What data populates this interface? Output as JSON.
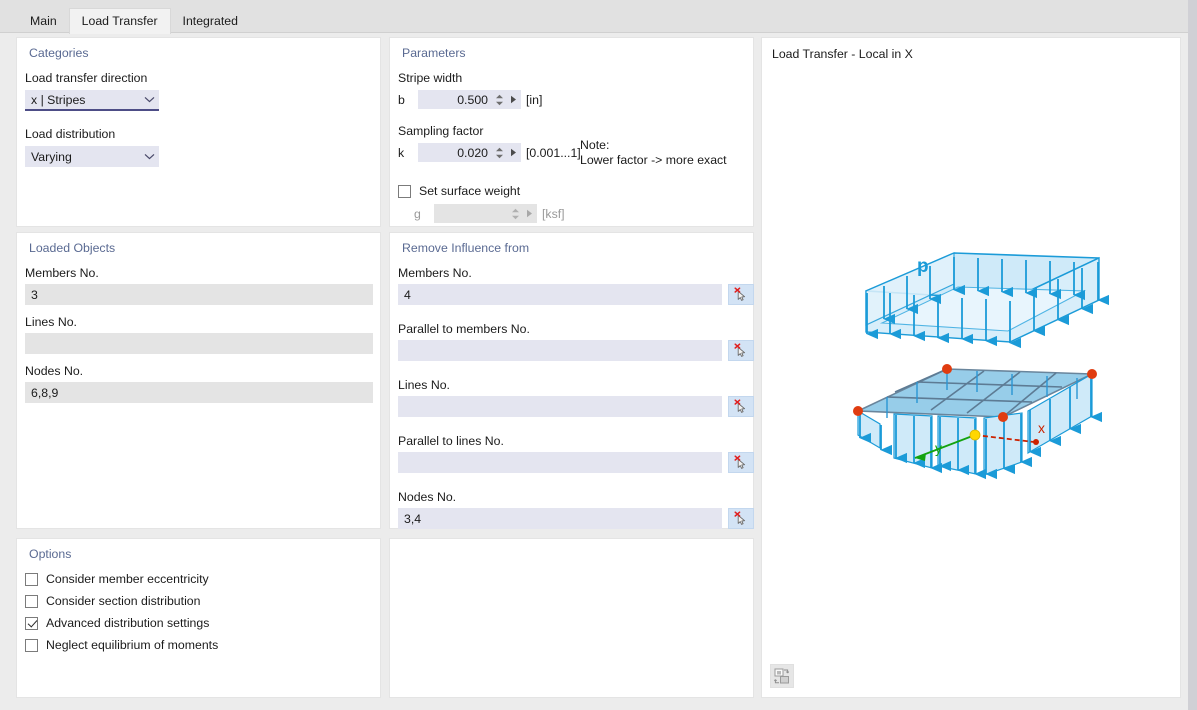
{
  "tabs": [
    {
      "label": "Main",
      "active": false
    },
    {
      "label": "Load Transfer",
      "active": true
    },
    {
      "label": "Integrated",
      "active": false
    }
  ],
  "categories": {
    "title": "Categories",
    "direction_label": "Load transfer direction",
    "direction_value": "x | Stripes",
    "distribution_label": "Load distribution",
    "distribution_value": "Varying"
  },
  "parameters": {
    "title": "Parameters",
    "stripe_width_label": "Stripe width",
    "stripe_width_symbol": "b",
    "stripe_width_value": "0.500",
    "stripe_width_unit": "[in]",
    "sampling_factor_label": "Sampling factor",
    "sampling_factor_symbol": "k",
    "sampling_factor_value": "0.020",
    "sampling_factor_range": "[0.001...1]",
    "note": "Note:\nLower factor -> more exact",
    "set_surface_weight_label": "Set surface weight",
    "set_surface_weight_checked": false,
    "surface_weight_symbol": "g",
    "surface_weight_value": "",
    "surface_weight_unit": "[ksf]"
  },
  "loaded_objects": {
    "title": "Loaded Objects",
    "fields": [
      {
        "label": "Members No.",
        "value": "3"
      },
      {
        "label": "Lines No.",
        "value": ""
      },
      {
        "label": "Nodes No.",
        "value": "6,8,9"
      }
    ]
  },
  "remove_influence": {
    "title": "Remove Influence from",
    "fields": [
      {
        "label": "Members No.",
        "value": "4"
      },
      {
        "label": "Parallel to members No.",
        "value": ""
      },
      {
        "label": "Lines No.",
        "value": ""
      },
      {
        "label": "Parallel to lines No.",
        "value": ""
      },
      {
        "label": "Nodes No.",
        "value": "3,4"
      }
    ]
  },
  "options": {
    "title": "Options",
    "items": [
      {
        "label": "Consider member eccentricity",
        "checked": false
      },
      {
        "label": "Consider section distribution",
        "checked": false
      },
      {
        "label": "Advanced distribution settings",
        "checked": true
      },
      {
        "label": "Neglect equilibrium of moments",
        "checked": false
      }
    ]
  },
  "view": {
    "title": "Load Transfer - Local in X",
    "diagram": {
      "load_label": "p",
      "axis_x_label": "x",
      "axis_y_label": "y",
      "surface_color": "#bfe3f7",
      "arrow_color": "#1b9bd8",
      "member_color": "#5d7b94",
      "node_color": "#e03c10",
      "origin_color": "#ffd700",
      "axis_x_color": "#cc2200",
      "axis_y_color": "#13a30e"
    },
    "toolbar_icon": "view-settings-icon"
  },
  "colors": {
    "panel_bg": "#ffffff",
    "window_bg": "#ececec",
    "group_title": "#5a6a92",
    "field_bg": "#e4e5f0",
    "readonly_bg": "#e4e4e4",
    "accent": "#4d4d86"
  }
}
